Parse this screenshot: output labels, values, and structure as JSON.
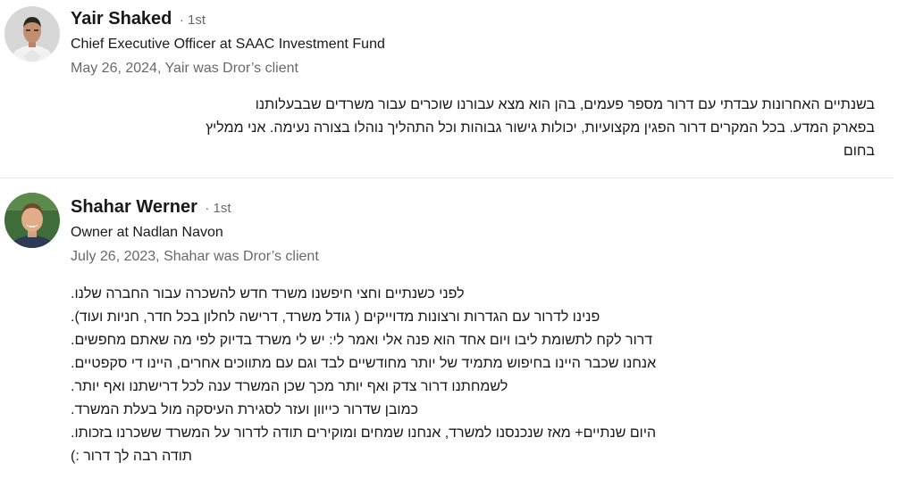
{
  "recommendations": [
    {
      "name": "Yair Shaked",
      "degree": "· 1st",
      "headline": "Chief Executive Officer at SAAC Investment Fund",
      "meta": "May 26, 2024, Yair was Dror’s client",
      "lines": [
        "בשנתיים האחרונות עבדתי עם דרור מספר פעמים, בהן הוא מצא עבורנו שוכרים עבור משרדים שבבעלותנו",
        "בפארק המדע. בכל המקרים דרור הפגין מקצועיות, יכולות גישור גבוהות וכל התהליך נוהלו בצורה נעימה. אני ממליץ",
        "בחום"
      ]
    },
    {
      "name": "Shahar Werner",
      "degree": "· 1st",
      "headline": "Owner at Nadlan Navon",
      "meta": "July 26, 2023, Shahar was Dror’s client",
      "lines": [
        "לפני כשנתיים וחצי חיפשנו משרד חדש להשכרה עבור החברה שלנו.",
        "פנינו לדרור עם הגדרות ורצונות מדוייקים ( גודל משרד, דרישה לחלון בכל חדר, חניות ועוד).",
        "דרור לקח לתשומת ליבו ויום אחד הוא פנה אלי ואמר לי: יש לי משרד בדיוק לפי מה שאתם מחפשים.",
        "אנחנו שכבר היינו בחיפוש מתמיד של יותר מחודשיים לבד וגם עם מתווכים אחרים, היינו די סקפטיים.",
        "לשמחתנו דרור צדק ואף יותר מכך שכן המשרד ענה לכל דרישתנו ואף יותר.",
        "כמובן שדרור כייוון ועזר לסגירת העיסקה מול בעלת המשרד.",
        "היום שנתיים+ מאז שנכנסנו למשרד, אנחנו שמחים ומוקירים תודה לדרור על המשרד ששכרנו בזכותו.",
        "תודה רבה לך דרור :)"
      ]
    }
  ]
}
